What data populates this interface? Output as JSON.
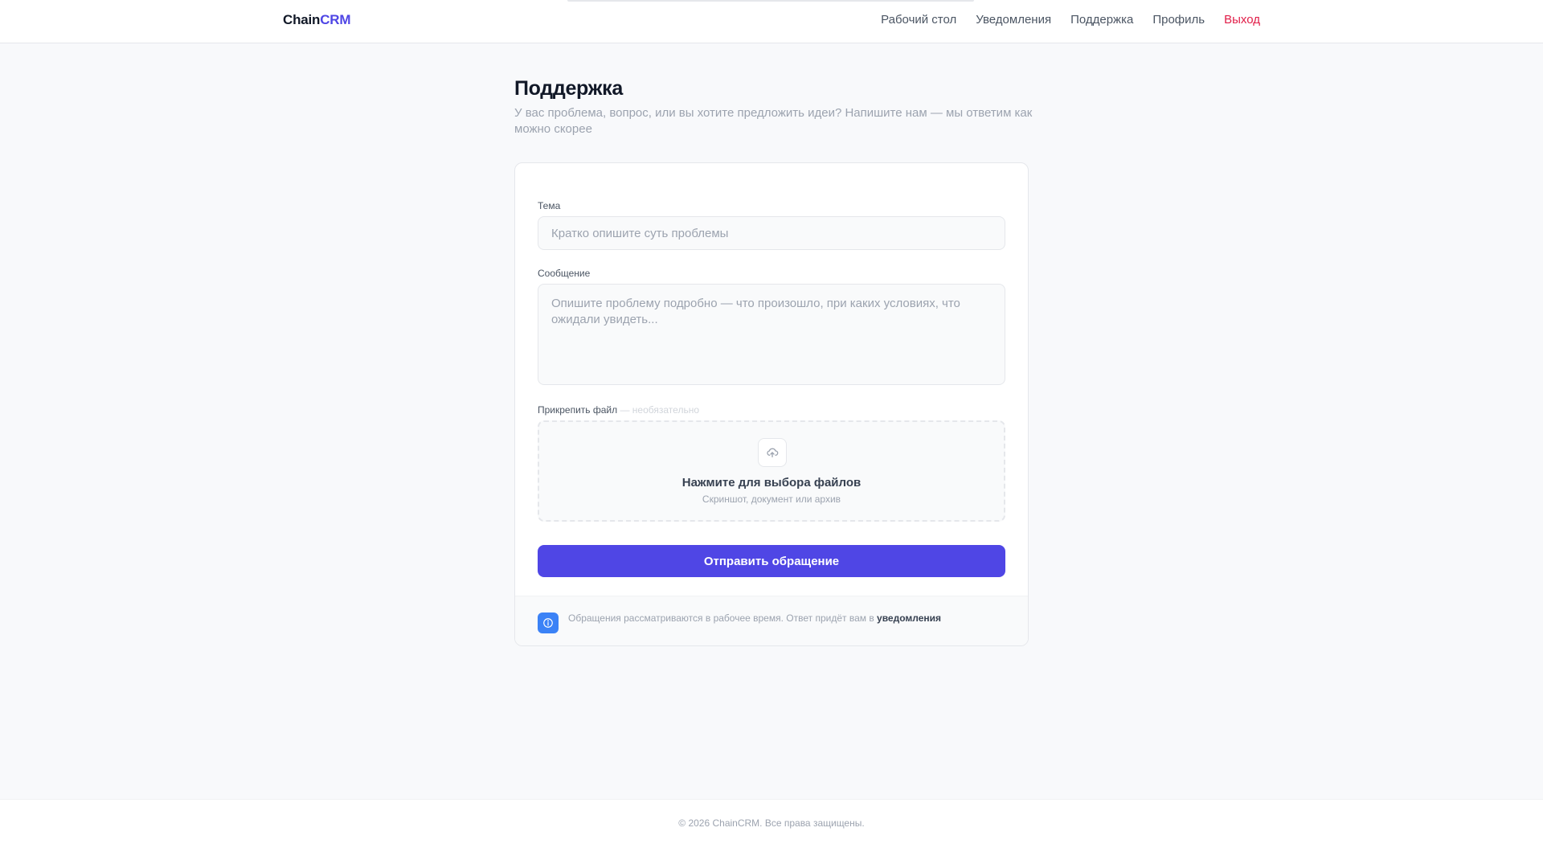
{
  "header": {
    "brand_part1": "Chain",
    "brand_part2": "CRM",
    "nav": {
      "dashboard": "Рабочий стол",
      "notifications": "Уведомления",
      "support": "Поддержка",
      "profile": "Профиль",
      "logout": "Выход"
    }
  },
  "page": {
    "title": "Поддержка",
    "subtitle": "У вас проблема, вопрос, или вы хотите предложить идеи? Напишите нам — мы ответим как можно скорее"
  },
  "form": {
    "subject_label": "Тема",
    "subject_value": "",
    "subject_placeholder": "Кратко опишите суть проблемы",
    "message_label": "Сообщение",
    "message_value": "",
    "message_placeholder": "Опишите проблему подробно — что произошло, при каких условиях, что ожидали увидеть...",
    "attach_label": "Прикрепить файл",
    "attach_optional": " — необязательно",
    "dropzone_title": "Нажмите для выбора файлов",
    "dropzone_hint": "Скриншот, документ или архив",
    "submit_label": "Отправить обращение"
  },
  "info": {
    "text": "Обращения рассматриваются в рабочее время. Ответ придёт вам в ",
    "link": "уведомления"
  },
  "footer": {
    "copyright": "© 2026 ChainCRM. Все права защищены."
  },
  "icons": {
    "upload": "upload-cloud-icon",
    "info": "info-icon"
  },
  "colors": {
    "accent": "#4f46e5",
    "logout": "#e11d48",
    "info_badge": "#3b82f6"
  }
}
